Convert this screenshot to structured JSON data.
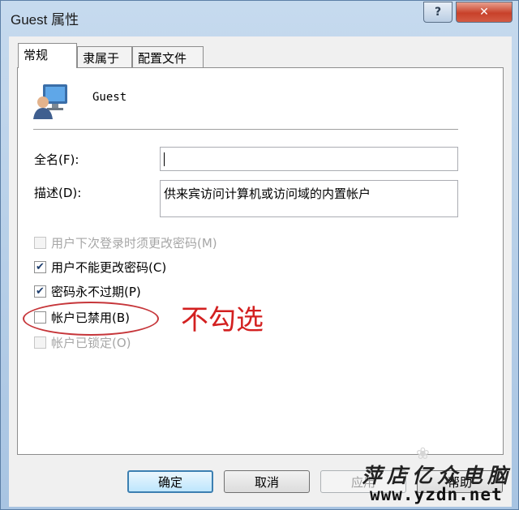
{
  "window": {
    "title": "Guest 属性",
    "help_glyph": "?",
    "close_glyph": "✕"
  },
  "tabs": [
    {
      "label": "常规",
      "active": true
    },
    {
      "label": "隶属于",
      "active": false
    },
    {
      "label": "配置文件",
      "active": false
    }
  ],
  "user": {
    "name": "Guest",
    "icon": "user-computer-icon"
  },
  "form": {
    "fullname_label": "全名(F):",
    "fullname_value": "",
    "description_label": "描述(D):",
    "description_value": "供来宾访问计算机或访问域的内置帐户"
  },
  "checkboxes": [
    {
      "label": "用户下次登录时须更改密码(M)",
      "checked": false,
      "enabled": false
    },
    {
      "label": "用户不能更改密码(C)",
      "checked": true,
      "enabled": true
    },
    {
      "label": "密码永不过期(P)",
      "checked": true,
      "enabled": true
    },
    {
      "label": "帐户已禁用(B)",
      "checked": false,
      "enabled": true
    },
    {
      "label": "帐户已锁定(O)",
      "checked": false,
      "enabled": false
    }
  ],
  "annotation": {
    "text": "不勾选",
    "color": "#d32020"
  },
  "buttons": {
    "ok": "确定",
    "cancel": "取消",
    "apply": "应用",
    "help": "帮助"
  },
  "watermark": {
    "line1": "萍店亿众电脑",
    "line2": "www.yzdn.net"
  },
  "colors": {
    "accent": "#3c7fb1",
    "close": "#c8412a"
  }
}
